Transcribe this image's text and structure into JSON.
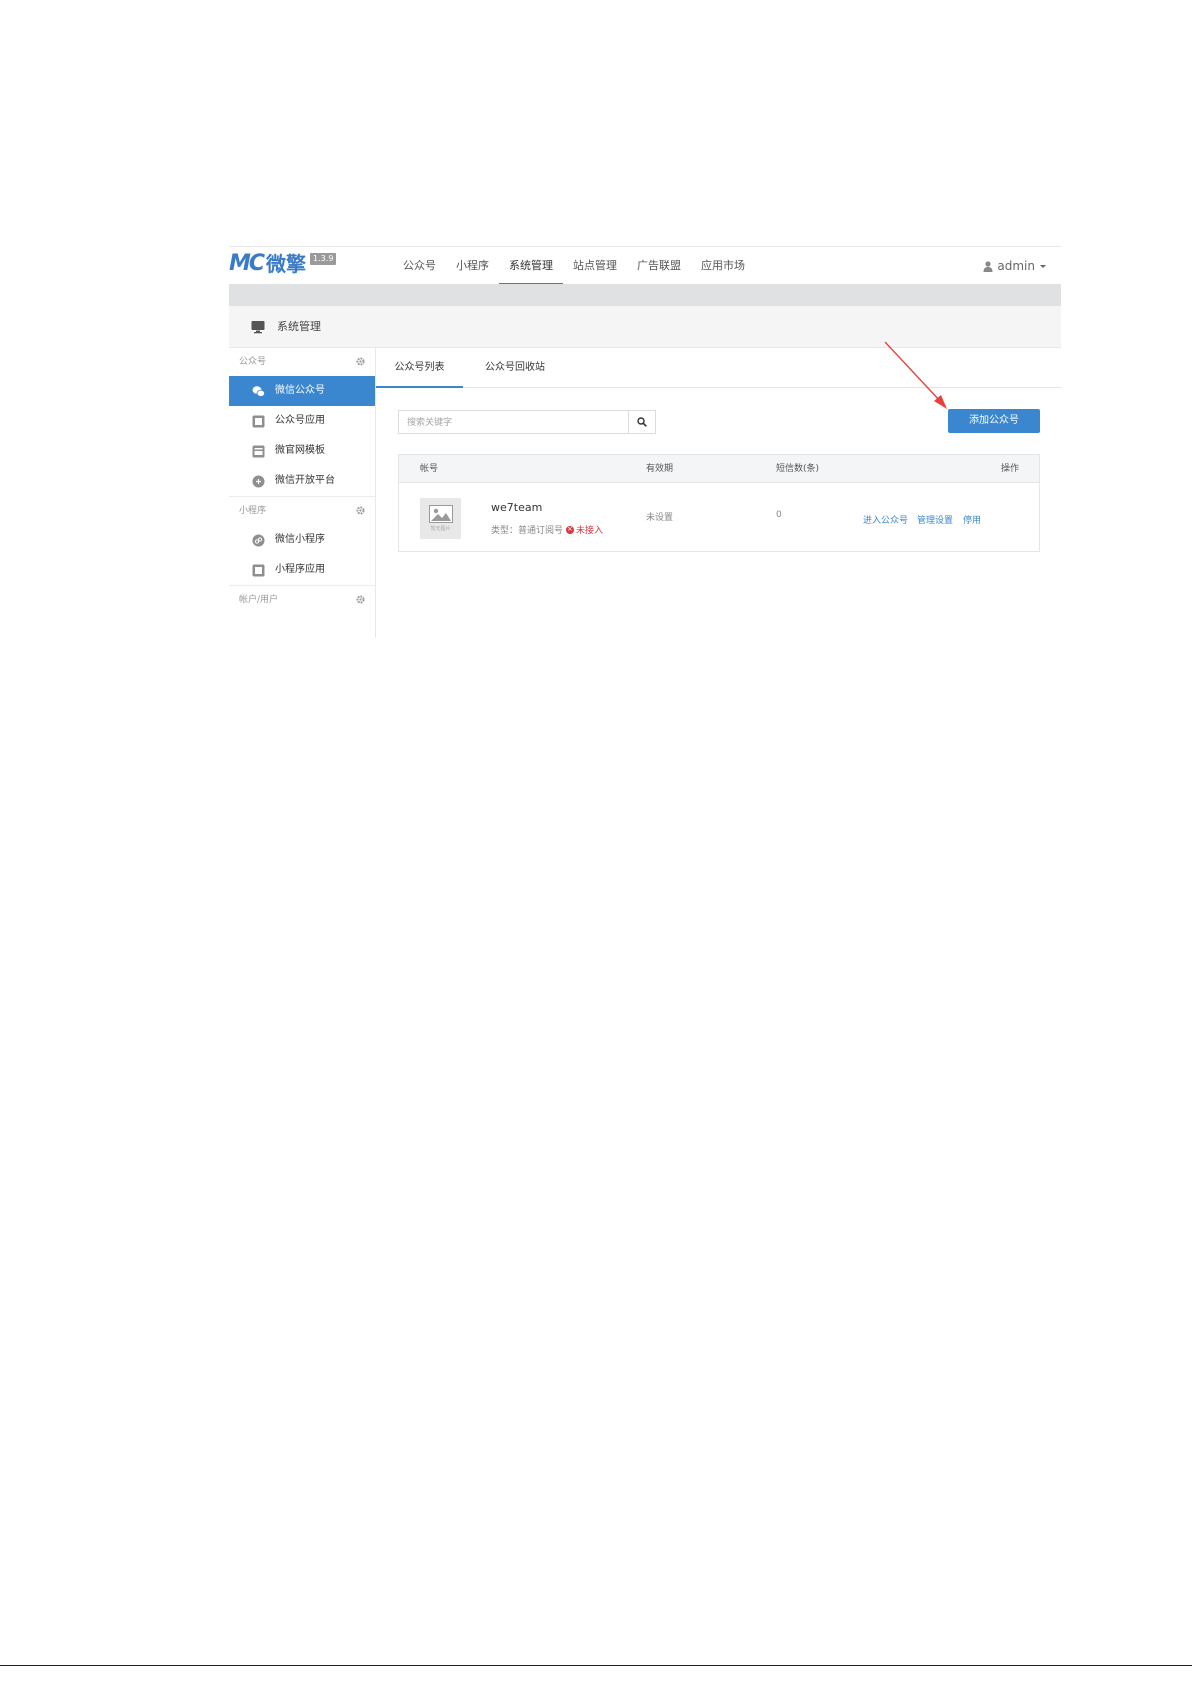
{
  "logo": {
    "mark": "MC",
    "name": "微擎",
    "version": "1.3.9"
  },
  "nav": {
    "items": [
      {
        "label": "公众号",
        "active": false
      },
      {
        "label": "小程序",
        "active": false
      },
      {
        "label": "系统管理",
        "active": true
      },
      {
        "label": "站点管理",
        "active": false
      },
      {
        "label": "广告联盟",
        "active": false
      },
      {
        "label": "应用市场",
        "active": false
      }
    ],
    "user": "admin"
  },
  "page": {
    "title": "系统管理"
  },
  "sidebar": {
    "groups": [
      {
        "label": "公众号",
        "items": [
          {
            "label": "微信公众号",
            "icon": "wechat-icon",
            "active": true
          },
          {
            "label": "公众号应用",
            "icon": "app-icon",
            "active": false
          },
          {
            "label": "微官网模板",
            "icon": "template-icon",
            "active": false
          },
          {
            "label": "微信开放平台",
            "icon": "open-platform-icon",
            "active": false
          }
        ]
      },
      {
        "label": "小程序",
        "items": [
          {
            "label": "微信小程序",
            "icon": "miniprogram-icon",
            "active": false
          },
          {
            "label": "小程序应用",
            "icon": "app-icon",
            "active": false
          }
        ]
      },
      {
        "label": "帐户/用户",
        "items": []
      }
    ]
  },
  "tabs": [
    {
      "label": "公众号列表",
      "active": true
    },
    {
      "label": "公众号回收站",
      "active": false
    }
  ],
  "search": {
    "placeholder": "搜索关键字",
    "value": ""
  },
  "add_button": "添加公众号",
  "table": {
    "headers": {
      "account": "帐号",
      "expiry": "有效期",
      "sms": "短信数(条)",
      "ops": "操作"
    },
    "rows": [
      {
        "avatar_caption": "暂无图片",
        "name": "we7team",
        "type": "类型：普通订阅号",
        "status": "未接入",
        "expiry": "未设置",
        "sms": "0",
        "actions": [
          "进入公众号",
          "管理设置",
          "停用"
        ]
      }
    ]
  },
  "colors": {
    "accent": "#3a87d0",
    "error": "#d9363e",
    "annotation_arrow": "#e8403a"
  }
}
